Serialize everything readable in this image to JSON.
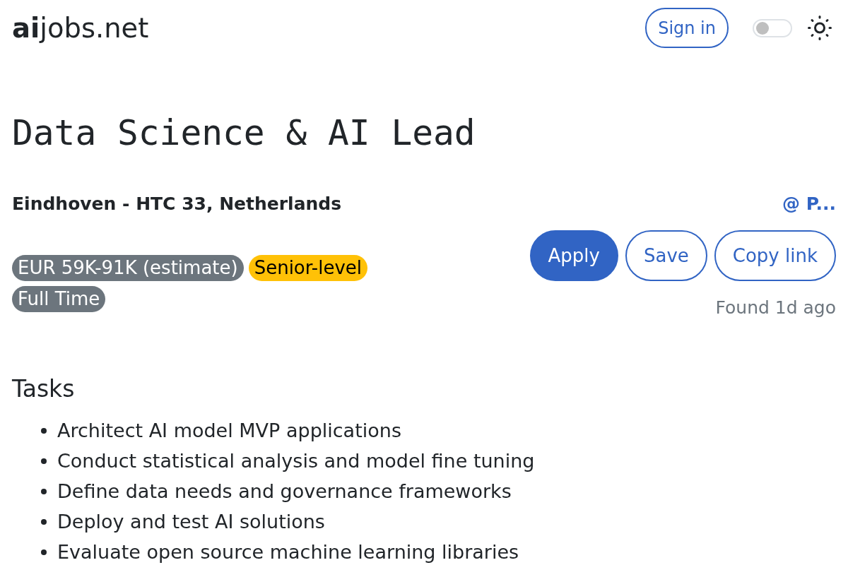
{
  "header": {
    "logo": "**ai**jobs.net",
    "sign_in": "Sign in",
    "theme_toggle": {
      "on": false
    }
  },
  "job": {
    "title": "Data Science & AI Lead",
    "location": "Eindhoven - HTC 33, Netherlands",
    "company": "@ P...",
    "tags": [
      {
        "label": "EUR 59K-91K (estimate)",
        "color": "#6c757d"
      },
      {
        "label": "Senior-level",
        "color": "#ffc107"
      },
      {
        "label": "Full Time",
        "color": "#6c757d"
      }
    ],
    "actions": [
      {
        "label": "Apply",
        "kind": "primary"
      },
      {
        "label": "Save",
        "kind": "outline"
      },
      {
        "label": "Copy link",
        "kind": "outline"
      }
    ],
    "found": "Found 1d ago"
  },
  "sections": [
    {
      "heading": "Tasks",
      "items": [
        "Architect AI model MVP applications",
        "Conduct statistical analysis and model fine tuning",
        "Define data needs and governance frameworks",
        "Deploy and test AI solutions",
        "Evaluate open source machine learning libraries"
      ]
    }
  ]
}
